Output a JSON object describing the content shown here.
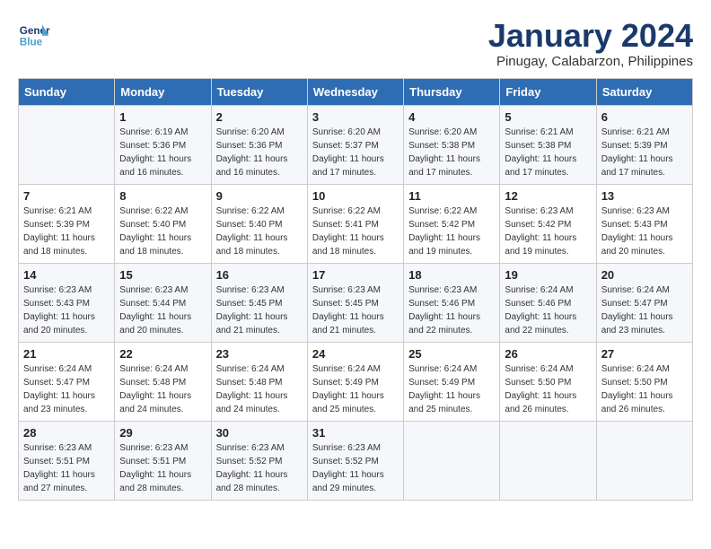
{
  "logo": {
    "text1": "General",
    "text2": "Blue"
  },
  "title": "January 2024",
  "subtitle": "Pinugay, Calabarzon, Philippines",
  "days": [
    "Sunday",
    "Monday",
    "Tuesday",
    "Wednesday",
    "Thursday",
    "Friday",
    "Saturday"
  ],
  "weeks": [
    [
      {
        "day": "",
        "sunrise": "",
        "sunset": "",
        "daylight": ""
      },
      {
        "day": "1",
        "sunrise": "Sunrise: 6:19 AM",
        "sunset": "Sunset: 5:36 PM",
        "daylight": "Daylight: 11 hours and 16 minutes."
      },
      {
        "day": "2",
        "sunrise": "Sunrise: 6:20 AM",
        "sunset": "Sunset: 5:36 PM",
        "daylight": "Daylight: 11 hours and 16 minutes."
      },
      {
        "day": "3",
        "sunrise": "Sunrise: 6:20 AM",
        "sunset": "Sunset: 5:37 PM",
        "daylight": "Daylight: 11 hours and 17 minutes."
      },
      {
        "day": "4",
        "sunrise": "Sunrise: 6:20 AM",
        "sunset": "Sunset: 5:38 PM",
        "daylight": "Daylight: 11 hours and 17 minutes."
      },
      {
        "day": "5",
        "sunrise": "Sunrise: 6:21 AM",
        "sunset": "Sunset: 5:38 PM",
        "daylight": "Daylight: 11 hours and 17 minutes."
      },
      {
        "day": "6",
        "sunrise": "Sunrise: 6:21 AM",
        "sunset": "Sunset: 5:39 PM",
        "daylight": "Daylight: 11 hours and 17 minutes."
      }
    ],
    [
      {
        "day": "7",
        "sunrise": "Sunrise: 6:21 AM",
        "sunset": "Sunset: 5:39 PM",
        "daylight": "Daylight: 11 hours and 18 minutes."
      },
      {
        "day": "8",
        "sunrise": "Sunrise: 6:22 AM",
        "sunset": "Sunset: 5:40 PM",
        "daylight": "Daylight: 11 hours and 18 minutes."
      },
      {
        "day": "9",
        "sunrise": "Sunrise: 6:22 AM",
        "sunset": "Sunset: 5:40 PM",
        "daylight": "Daylight: 11 hours and 18 minutes."
      },
      {
        "day": "10",
        "sunrise": "Sunrise: 6:22 AM",
        "sunset": "Sunset: 5:41 PM",
        "daylight": "Daylight: 11 hours and 18 minutes."
      },
      {
        "day": "11",
        "sunrise": "Sunrise: 6:22 AM",
        "sunset": "Sunset: 5:42 PM",
        "daylight": "Daylight: 11 hours and 19 minutes."
      },
      {
        "day": "12",
        "sunrise": "Sunrise: 6:23 AM",
        "sunset": "Sunset: 5:42 PM",
        "daylight": "Daylight: 11 hours and 19 minutes."
      },
      {
        "day": "13",
        "sunrise": "Sunrise: 6:23 AM",
        "sunset": "Sunset: 5:43 PM",
        "daylight": "Daylight: 11 hours and 20 minutes."
      }
    ],
    [
      {
        "day": "14",
        "sunrise": "Sunrise: 6:23 AM",
        "sunset": "Sunset: 5:43 PM",
        "daylight": "Daylight: 11 hours and 20 minutes."
      },
      {
        "day": "15",
        "sunrise": "Sunrise: 6:23 AM",
        "sunset": "Sunset: 5:44 PM",
        "daylight": "Daylight: 11 hours and 20 minutes."
      },
      {
        "day": "16",
        "sunrise": "Sunrise: 6:23 AM",
        "sunset": "Sunset: 5:45 PM",
        "daylight": "Daylight: 11 hours and 21 minutes."
      },
      {
        "day": "17",
        "sunrise": "Sunrise: 6:23 AM",
        "sunset": "Sunset: 5:45 PM",
        "daylight": "Daylight: 11 hours and 21 minutes."
      },
      {
        "day": "18",
        "sunrise": "Sunrise: 6:23 AM",
        "sunset": "Sunset: 5:46 PM",
        "daylight": "Daylight: 11 hours and 22 minutes."
      },
      {
        "day": "19",
        "sunrise": "Sunrise: 6:24 AM",
        "sunset": "Sunset: 5:46 PM",
        "daylight": "Daylight: 11 hours and 22 minutes."
      },
      {
        "day": "20",
        "sunrise": "Sunrise: 6:24 AM",
        "sunset": "Sunset: 5:47 PM",
        "daylight": "Daylight: 11 hours and 23 minutes."
      }
    ],
    [
      {
        "day": "21",
        "sunrise": "Sunrise: 6:24 AM",
        "sunset": "Sunset: 5:47 PM",
        "daylight": "Daylight: 11 hours and 23 minutes."
      },
      {
        "day": "22",
        "sunrise": "Sunrise: 6:24 AM",
        "sunset": "Sunset: 5:48 PM",
        "daylight": "Daylight: 11 hours and 24 minutes."
      },
      {
        "day": "23",
        "sunrise": "Sunrise: 6:24 AM",
        "sunset": "Sunset: 5:48 PM",
        "daylight": "Daylight: 11 hours and 24 minutes."
      },
      {
        "day": "24",
        "sunrise": "Sunrise: 6:24 AM",
        "sunset": "Sunset: 5:49 PM",
        "daylight": "Daylight: 11 hours and 25 minutes."
      },
      {
        "day": "25",
        "sunrise": "Sunrise: 6:24 AM",
        "sunset": "Sunset: 5:49 PM",
        "daylight": "Daylight: 11 hours and 25 minutes."
      },
      {
        "day": "26",
        "sunrise": "Sunrise: 6:24 AM",
        "sunset": "Sunset: 5:50 PM",
        "daylight": "Daylight: 11 hours and 26 minutes."
      },
      {
        "day": "27",
        "sunrise": "Sunrise: 6:24 AM",
        "sunset": "Sunset: 5:50 PM",
        "daylight": "Daylight: 11 hours and 26 minutes."
      }
    ],
    [
      {
        "day": "28",
        "sunrise": "Sunrise: 6:23 AM",
        "sunset": "Sunset: 5:51 PM",
        "daylight": "Daylight: 11 hours and 27 minutes."
      },
      {
        "day": "29",
        "sunrise": "Sunrise: 6:23 AM",
        "sunset": "Sunset: 5:51 PM",
        "daylight": "Daylight: 11 hours and 28 minutes."
      },
      {
        "day": "30",
        "sunrise": "Sunrise: 6:23 AM",
        "sunset": "Sunset: 5:52 PM",
        "daylight": "Daylight: 11 hours and 28 minutes."
      },
      {
        "day": "31",
        "sunrise": "Sunrise: 6:23 AM",
        "sunset": "Sunset: 5:52 PM",
        "daylight": "Daylight: 11 hours and 29 minutes."
      },
      {
        "day": "",
        "sunrise": "",
        "sunset": "",
        "daylight": ""
      },
      {
        "day": "",
        "sunrise": "",
        "sunset": "",
        "daylight": ""
      },
      {
        "day": "",
        "sunrise": "",
        "sunset": "",
        "daylight": ""
      }
    ]
  ]
}
